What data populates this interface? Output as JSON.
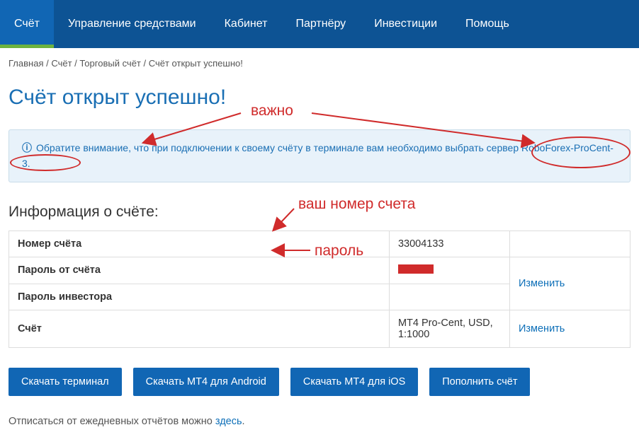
{
  "nav": {
    "items": [
      "Счёт",
      "Управление средствами",
      "Кабинет",
      "Партнёру",
      "Инвестиции",
      "Помощь"
    ]
  },
  "breadcrumb": {
    "items": [
      "Главная",
      "Счёт",
      "Торговый счёт",
      "Счёт открыт успешно!"
    ]
  },
  "page_title": "Счёт открыт успешно!",
  "notice": "Обратите внимание, что при подключении к своему счёту в терминале вам необходимо выбрать сервер RoboForex-ProCent-3.",
  "section_title": "Информация о счёте:",
  "table": {
    "rows": [
      {
        "label": "Номер счёта",
        "value": "33004133",
        "action": ""
      },
      {
        "label": "Пароль от счёта",
        "value": "",
        "action": "Изменить"
      },
      {
        "label": "Пароль инвестора",
        "value": "",
        "action": ""
      },
      {
        "label": "Счёт",
        "value": "MT4 Pro-Cent, USD, 1:1000",
        "action": "Изменить"
      }
    ]
  },
  "buttons": {
    "download_terminal": "Скачать терминал",
    "download_mt4_android": "Скачать МТ4 для Android",
    "download_mt4_ios": "Скачать МТ4 для іOS",
    "fund_account": "Пополнить счёт"
  },
  "footer": {
    "text": "Отписаться от ежедневных отчётов можно ",
    "link": "здесь"
  },
  "annotations": {
    "important": "важно",
    "account_number": "ваш номер счета",
    "password": "пароль"
  }
}
